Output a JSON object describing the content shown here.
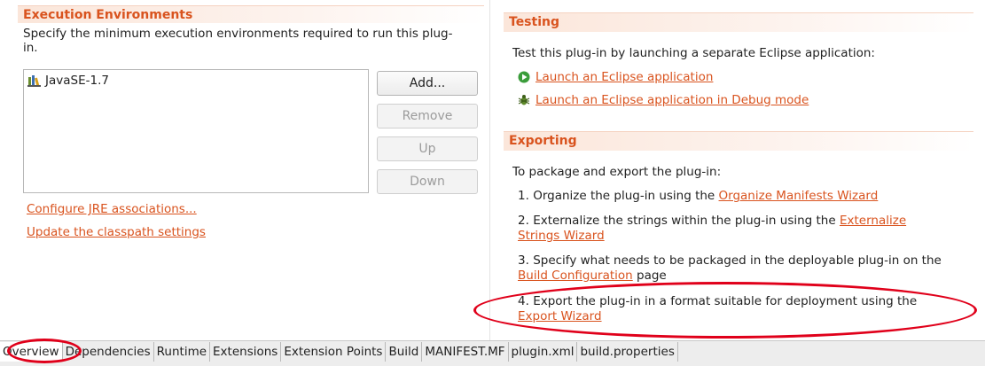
{
  "exec_env": {
    "title": "Execution Environments",
    "description_line1": "Specify the minimum execution environments required to run this plug-",
    "description_line2": "in.",
    "items": [
      "JavaSE-1.7"
    ],
    "buttons": {
      "add": "Add...",
      "remove": "Remove",
      "up": "Up",
      "down": "Down"
    },
    "links": {
      "configure_jre": "Configure JRE associations...",
      "update_classpath": "Update the classpath settings"
    }
  },
  "testing": {
    "title": "Testing",
    "description": "Test this plug-in by launching a separate Eclipse application:",
    "launch_link": "Launch an Eclipse application",
    "debug_link": "Launch an Eclipse application in Debug mode"
  },
  "exporting": {
    "title": "Exporting",
    "description": "To package and export the plug-in:",
    "steps": [
      {
        "num": "1.",
        "text": "Organize the plug-in using the ",
        "link": "Organize Manifests Wizard",
        "after": ""
      },
      {
        "num": "2.",
        "text": "Externalize the strings within the plug-in using the ",
        "link": "Externalize Strings Wizard",
        "after": ""
      },
      {
        "num": "3.",
        "text": "Specify what needs to be packaged in the deployable plug-in on the ",
        "link": "Build Configuration",
        "after": " page"
      },
      {
        "num": "4.",
        "text": "Export the plug-in in a format suitable for deployment using the ",
        "link": "Export Wizard",
        "after": ""
      }
    ]
  },
  "tabs": [
    "Overview",
    "Dependencies",
    "Runtime",
    "Extensions",
    "Extension Points",
    "Build",
    "MANIFEST.MF",
    "plugin.xml",
    "build.properties"
  ],
  "colors": {
    "accent": "#d9531e",
    "annotation": "#e0001a"
  }
}
